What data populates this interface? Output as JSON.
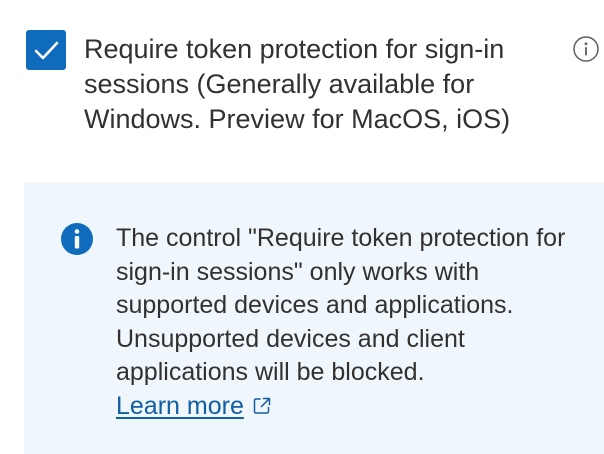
{
  "option": {
    "checked": true,
    "label": "Require token protection for sign-in sessions (Generally available for Windows. Preview for MacOS, iOS)",
    "info_icon": "info-outline-icon"
  },
  "message_bar": {
    "icon": "info-filled-icon",
    "text": "The control \"Require token protection for sign-in sessions\" only works with supported devices and applications. Unsupported devices and client applications will be blocked.",
    "link_label": "Learn more",
    "link_icon": "external-link-icon"
  },
  "colors": {
    "accent": "#0f6cbd",
    "message_background": "#eff6fc",
    "link": "#115ea3",
    "text": "#323130"
  }
}
